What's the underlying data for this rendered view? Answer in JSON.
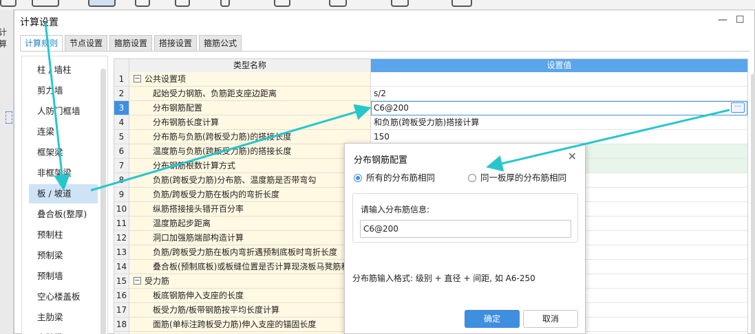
{
  "window": {
    "title": "计算设置",
    "minimize": "—",
    "maximize": "☐"
  },
  "background": {
    "partial_label": "计算"
  },
  "tabs": [
    "计算规则",
    "节点设置",
    "箍筋设置",
    "搭接设置",
    "箍筋公式"
  ],
  "sidebar": {
    "items": [
      "柱 / 墙柱",
      "剪力墙",
      "人防门框墙",
      "连梁",
      "框架梁",
      "非框架梁",
      "板 / 坡道",
      "叠合板(整厚)",
      "预制柱",
      "预制梁",
      "预制墙",
      "空心楼盖板",
      "主肋梁",
      "次肋梁"
    ]
  },
  "grid": {
    "headers": {
      "name": "类型名称",
      "value": "设置值"
    },
    "rows": [
      {
        "no": "1",
        "name": "公共设置项",
        "value": "",
        "group": true
      },
      {
        "no": "2",
        "name": "起始受力钢筋、负筋距支座边距离",
        "value": "s/2"
      },
      {
        "no": "3",
        "name": "分布钢筋配置",
        "value": "C6@200",
        "selected": true
      },
      {
        "no": "4",
        "name": "分布钢筋长度计算",
        "value": "和负筋(跨板受力筋)搭接计算"
      },
      {
        "no": "5",
        "name": "分布筋与负筋(跨板受力筋)的搭接长度",
        "value": "150"
      },
      {
        "no": "6",
        "name": "温度筋与负筋(跨板受力筋)的搭接长度",
        "value": "",
        "green": true
      },
      {
        "no": "7",
        "name": "分布钢筋根数计算方式",
        "value": "",
        "green": true
      },
      {
        "no": "8",
        "name": "负筋(跨板受力筋)分布筋、温度筋是否带弯勾",
        "value": ""
      },
      {
        "no": "9",
        "name": "负筋/跨板受力筋在板内的弯折长度",
        "value": ""
      },
      {
        "no": "10",
        "name": "纵筋搭接接头错开百分率",
        "value": ""
      },
      {
        "no": "11",
        "name": "温度筋起步距离",
        "value": ""
      },
      {
        "no": "12",
        "name": "洞口加强筋端部构造计算",
        "value": ""
      },
      {
        "no": "13",
        "name": "负筋/跨板受力筋在板内弯折遇预制底板时弯折长度",
        "value": ""
      },
      {
        "no": "14",
        "name": "叠合板(预制底板)或板缝位置是否计算现浇板马凳筋和",
        "value": ""
      },
      {
        "no": "15",
        "name": "受力筋",
        "value": "",
        "group": true
      },
      {
        "no": "16",
        "name": "板底钢筋伸入支座的长度",
        "value": ""
      },
      {
        "no": "17",
        "name": "板受力筋/板带钢筋按平均长度计算",
        "value": ""
      },
      {
        "no": "18",
        "name": "面筋(单标注跨板受力筋)伸入支座的锚固长度",
        "value": ""
      },
      {
        "no": "19",
        "name": "",
        "value": ""
      }
    ],
    "ellipsis_label": "···"
  },
  "dialog": {
    "title": "分布钢筋配置",
    "close": "✕",
    "radio_all": "所有的分布筋相同",
    "radio_same_thickness": "同一板厚的分布筋相同",
    "selected_option": "all",
    "input_label": "请输入分布筋信息:",
    "input_value": "C6@200",
    "hint": "分布筋输入格式: 级别 + 直径 + 间距, 如 A6-250",
    "ok": "确定",
    "cancel": "取消"
  },
  "colors": {
    "accent": "#3f8fe0",
    "header_value_bg": "#5aa5ec",
    "name_col_bg": "#fff8e3",
    "green_row_bg": "#e7f5ea",
    "arrow": "#26c6cc"
  }
}
